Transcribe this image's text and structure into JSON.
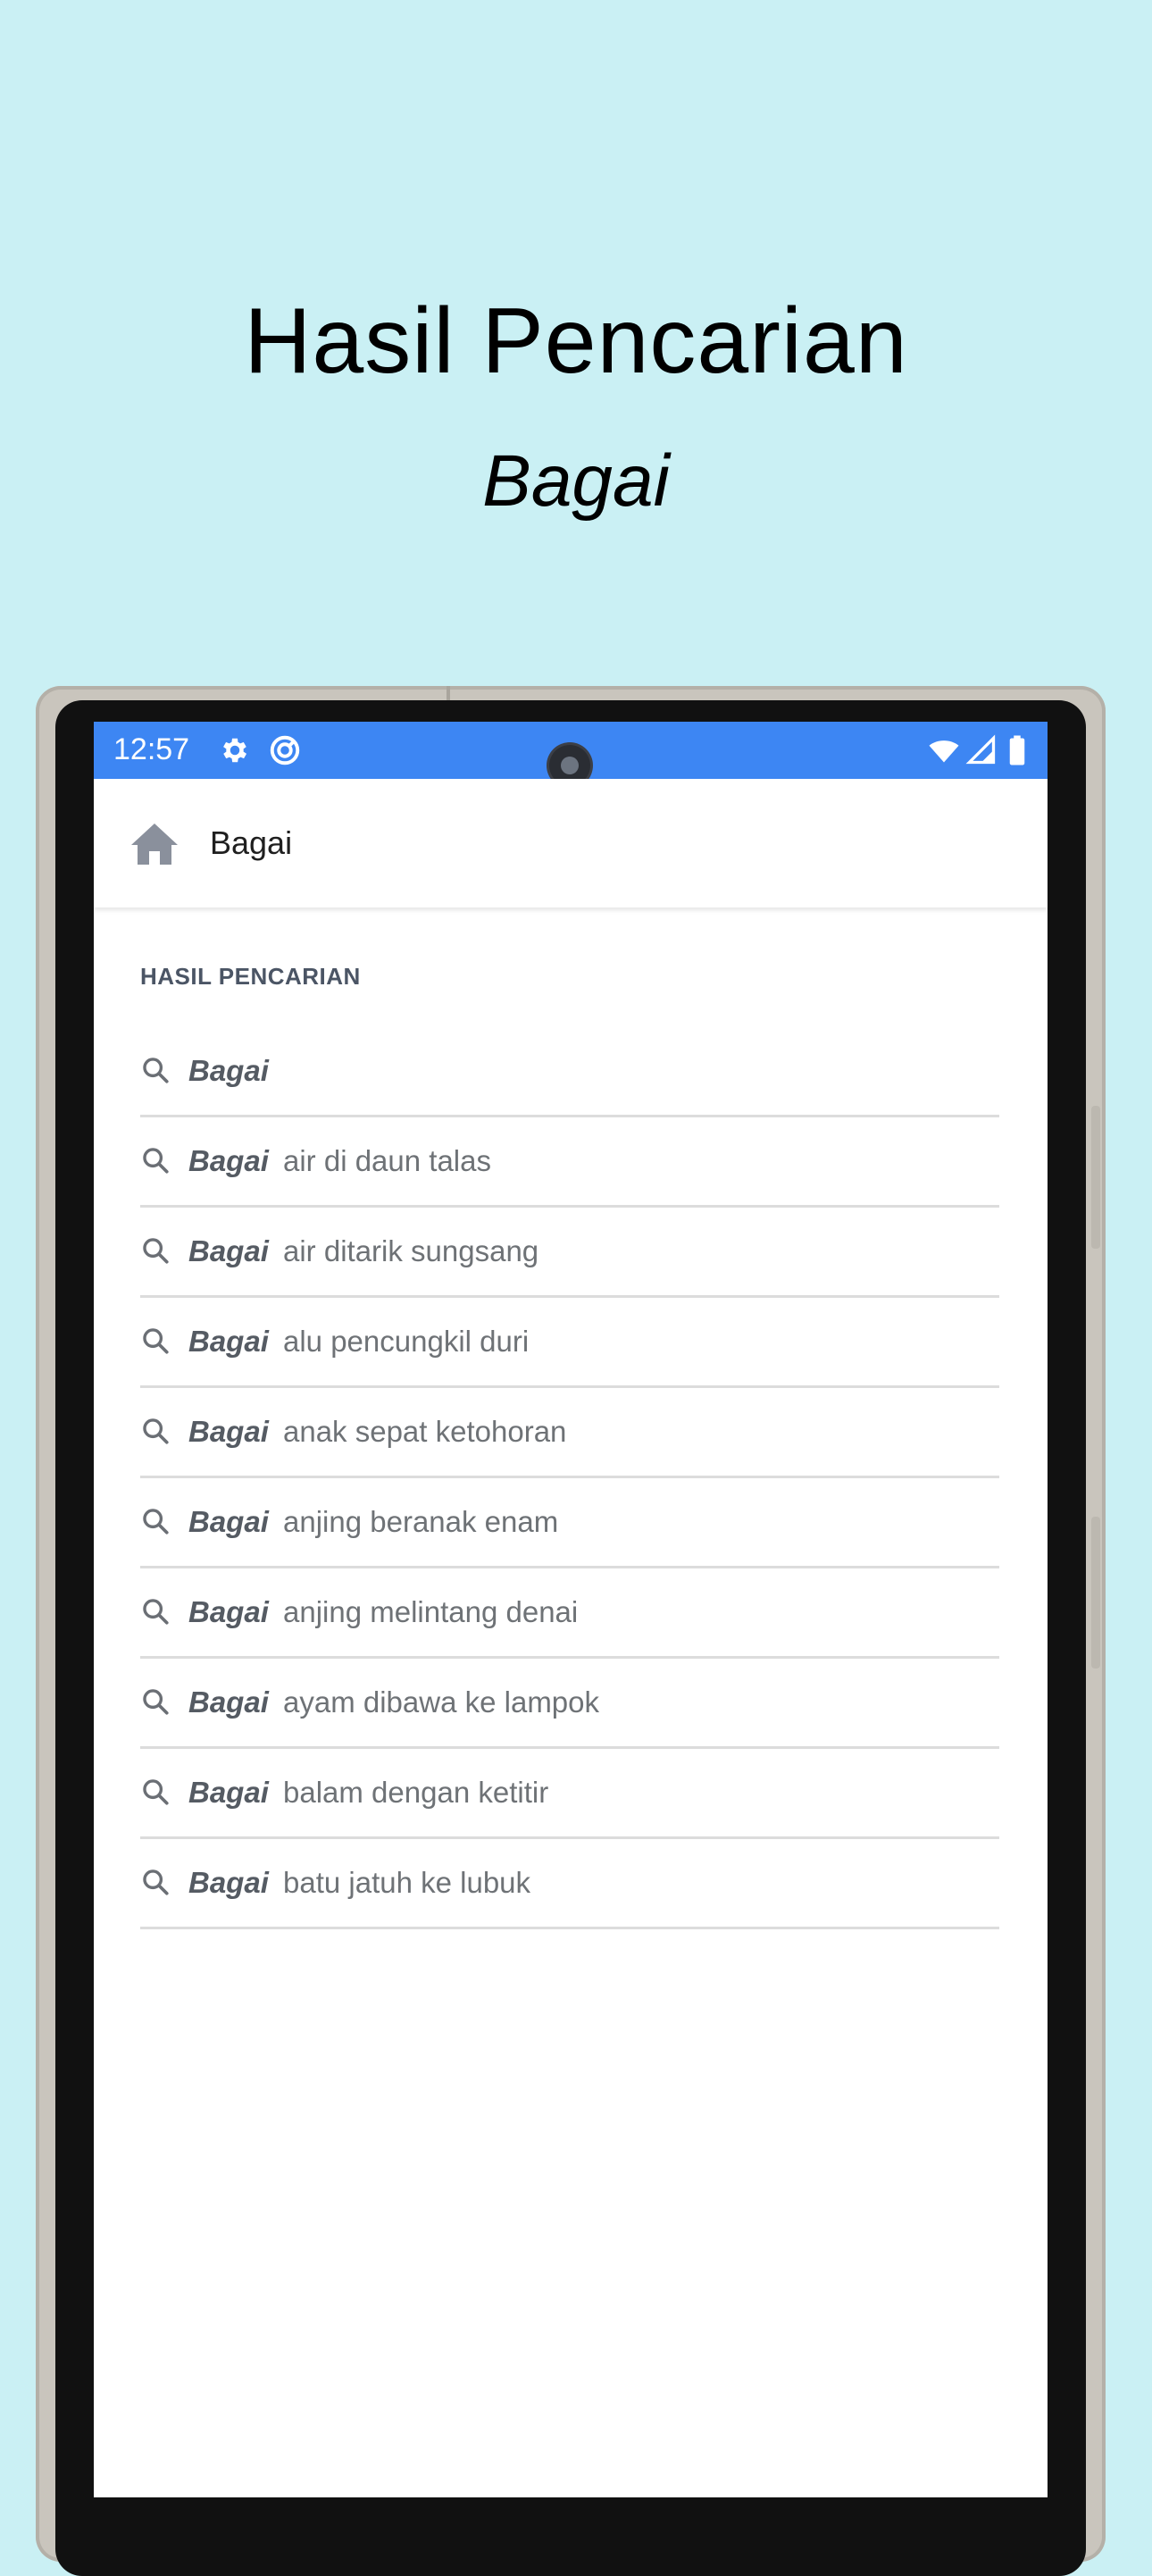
{
  "promo": {
    "title": "Hasil Pencarian",
    "subtitle": "Bagai"
  },
  "status_bar": {
    "time": "12:57",
    "left_icons": [
      "gear-icon",
      "sync-icon"
    ],
    "right_icons": [
      "wifi-icon",
      "signal-icon",
      "battery-icon"
    ],
    "color": "#3d86f3"
  },
  "app_bar": {
    "title": "Bagai",
    "icon": "home-icon"
  },
  "results": {
    "section_title": "HASIL PENCARIAN",
    "items": [
      {
        "keyword": "Bagai",
        "rest": ""
      },
      {
        "keyword": "Bagai",
        "rest": "air di daun talas"
      },
      {
        "keyword": "Bagai",
        "rest": "air ditarik sungsang"
      },
      {
        "keyword": "Bagai",
        "rest": "alu pencungkil duri"
      },
      {
        "keyword": "Bagai",
        "rest": "anak sepat ketohoran"
      },
      {
        "keyword": "Bagai",
        "rest": "anjing beranak enam"
      },
      {
        "keyword": "Bagai",
        "rest": "anjing melintang denai"
      },
      {
        "keyword": "Bagai",
        "rest": "ayam dibawa ke lampok"
      },
      {
        "keyword": "Bagai",
        "rest": "balam dengan ketitir"
      },
      {
        "keyword": "Bagai",
        "rest": "batu jatuh ke lubuk"
      }
    ]
  },
  "colors": {
    "background": "#caf0f4",
    "accent": "#3d86f3",
    "divider": "#dcdcdc"
  }
}
